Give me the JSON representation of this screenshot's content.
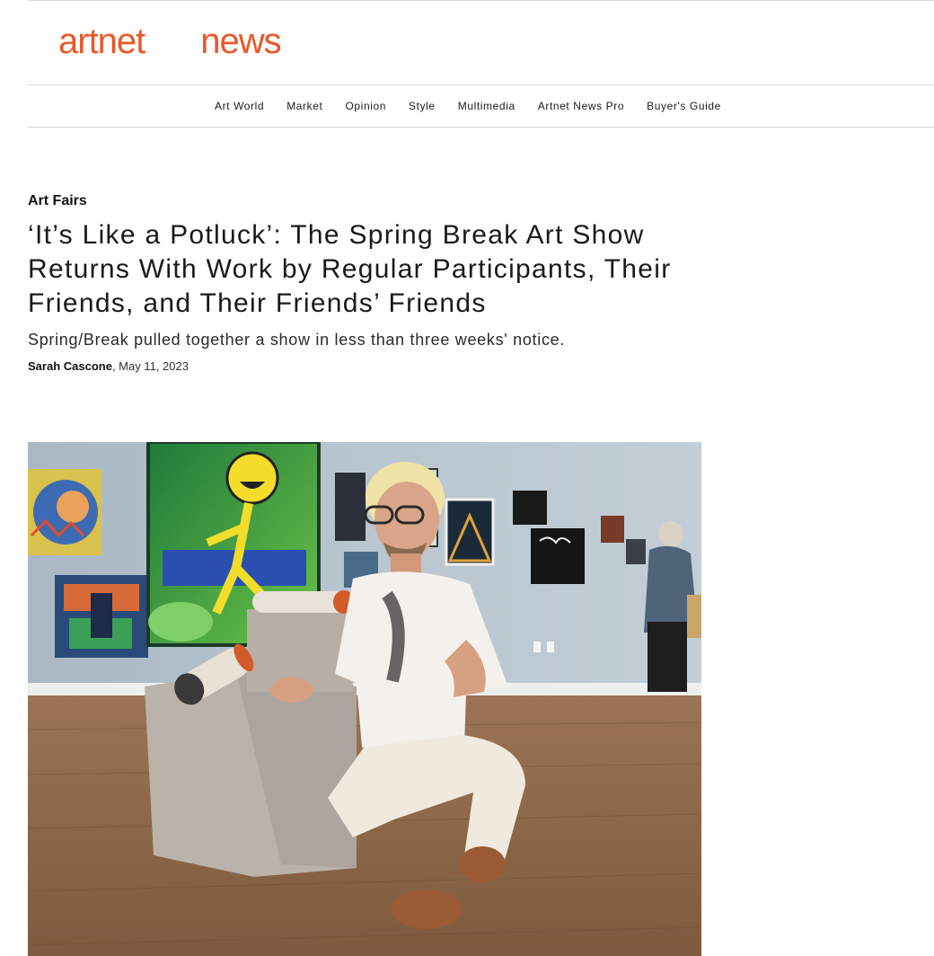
{
  "brand": {
    "logo_left": "artnet",
    "logo_right": "news",
    "accent_color": "#e9582a"
  },
  "nav": {
    "items": [
      {
        "label": "Art World"
      },
      {
        "label": "Market"
      },
      {
        "label": "Opinion"
      },
      {
        "label": "Style"
      },
      {
        "label": "Multimedia"
      },
      {
        "label": "Artnet News Pro"
      },
      {
        "label": "Buyer's Guide"
      }
    ]
  },
  "article": {
    "category": "Art Fairs",
    "title": "‘It’s Like a Potluck’: The Spring Break Art Show Returns With Work by Regular Participants, Their Friends, and Their Friends’ Friends",
    "subtitle": "Spring/Break pulled together a show in less than three weeks' notice.",
    "author": "Sarah Cascone",
    "date_separator": ", ",
    "date": "May 11, 2023"
  },
  "hero_image": {
    "icon": "photo-gallery-scene"
  }
}
